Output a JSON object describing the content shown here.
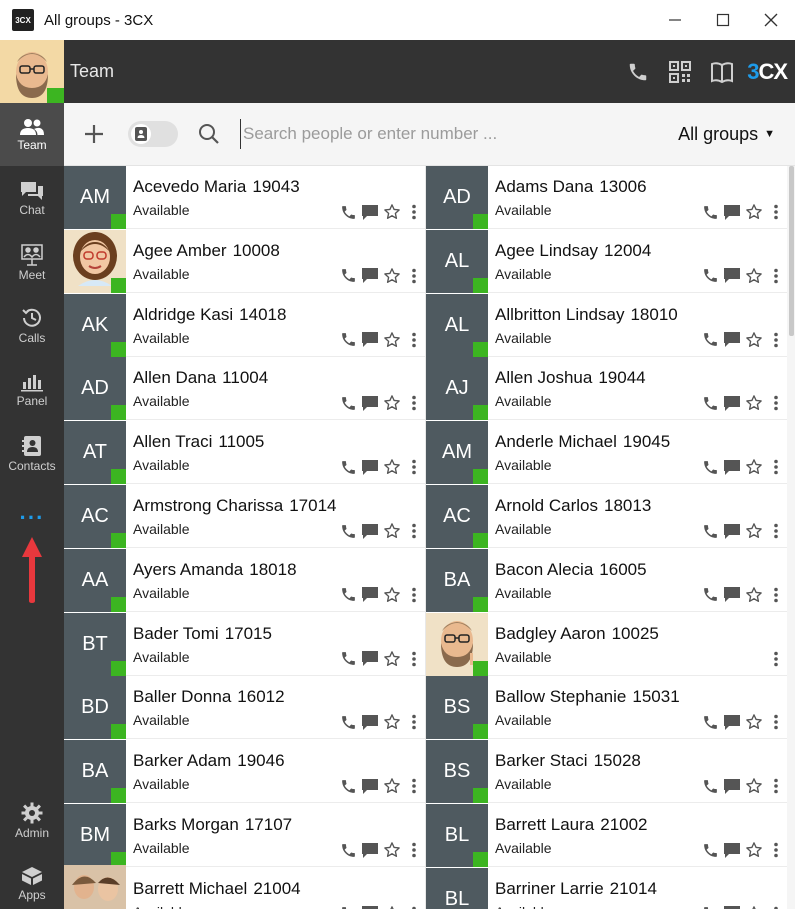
{
  "window": {
    "title": "All groups - 3CX",
    "logo": "3CX"
  },
  "header": {
    "title": "Team",
    "brand": "3CX"
  },
  "sidebar": {
    "items": [
      {
        "label": "Team",
        "icon": "team-icon"
      },
      {
        "label": "Chat",
        "icon": "chat-icon"
      },
      {
        "label": "Meet",
        "icon": "meet-icon"
      },
      {
        "label": "Calls",
        "icon": "calls-icon"
      },
      {
        "label": "Panel",
        "icon": "panel-icon"
      },
      {
        "label": "Contacts",
        "icon": "contacts-icon"
      },
      {
        "label": "Admin",
        "icon": "gear-icon"
      },
      {
        "label": "Apps",
        "icon": "apps-icon"
      }
    ],
    "more": "···"
  },
  "toolbar": {
    "search_placeholder": "Search people or enter number ...",
    "group_filter": "All groups"
  },
  "colors": {
    "accent": "#1e9be9",
    "status_available": "#3cb521",
    "sidebar": "#333333"
  },
  "contacts": [
    {
      "initials": "AM",
      "name": "Acevedo Maria",
      "ext": "19043",
      "status": "Available"
    },
    {
      "initials": "AD",
      "name": "Adams Dana",
      "ext": "13006",
      "status": "Available"
    },
    {
      "initials": "",
      "name": "Agee Amber",
      "ext": "10008",
      "status": "Available",
      "photo": true
    },
    {
      "initials": "AL",
      "name": "Agee Lindsay",
      "ext": "12004",
      "status": "Available"
    },
    {
      "initials": "AK",
      "name": "Aldridge Kasi",
      "ext": "14018",
      "status": "Available"
    },
    {
      "initials": "AL",
      "name": "Allbritton Lindsay",
      "ext": "18010",
      "status": "Available"
    },
    {
      "initials": "AD",
      "name": "Allen Dana",
      "ext": "11004",
      "status": "Available"
    },
    {
      "initials": "AJ",
      "name": "Allen Joshua",
      "ext": "19044",
      "status": "Available"
    },
    {
      "initials": "AT",
      "name": "Allen Traci",
      "ext": "11005",
      "status": "Available"
    },
    {
      "initials": "AM",
      "name": "Anderle Michael",
      "ext": "19045",
      "status": "Available"
    },
    {
      "initials": "AC",
      "name": "Armstrong Charissa",
      "ext": "17014",
      "status": "Available"
    },
    {
      "initials": "AC",
      "name": "Arnold Carlos",
      "ext": "18013",
      "status": "Available"
    },
    {
      "initials": "AA",
      "name": "Ayers Amanda",
      "ext": "18018",
      "status": "Available"
    },
    {
      "initials": "BA",
      "name": "Bacon Alecia",
      "ext": "16005",
      "status": "Available"
    },
    {
      "initials": "BT",
      "name": "Bader Tomi",
      "ext": "17015",
      "status": "Available"
    },
    {
      "initials": "",
      "name": "Badgley Aaron",
      "ext": "10025",
      "status": "Available",
      "photo": true,
      "self": true
    },
    {
      "initials": "BD",
      "name": "Baller Donna",
      "ext": "16012",
      "status": "Available"
    },
    {
      "initials": "BS",
      "name": "Ballow Stephanie",
      "ext": "15031",
      "status": "Available"
    },
    {
      "initials": "BA",
      "name": "Barker Adam",
      "ext": "19046",
      "status": "Available"
    },
    {
      "initials": "BS",
      "name": "Barker Staci",
      "ext": "15028",
      "status": "Available"
    },
    {
      "initials": "BM",
      "name": "Barks Morgan",
      "ext": "17107",
      "status": "Available"
    },
    {
      "initials": "BL",
      "name": "Barrett Laura",
      "ext": "21002",
      "status": "Available"
    },
    {
      "initials": "",
      "name": "Barrett Michael",
      "ext": "21004",
      "status": "Available",
      "photo": true
    },
    {
      "initials": "BL",
      "name": "Barriner Larrie",
      "ext": "21014",
      "status": "Available"
    }
  ]
}
